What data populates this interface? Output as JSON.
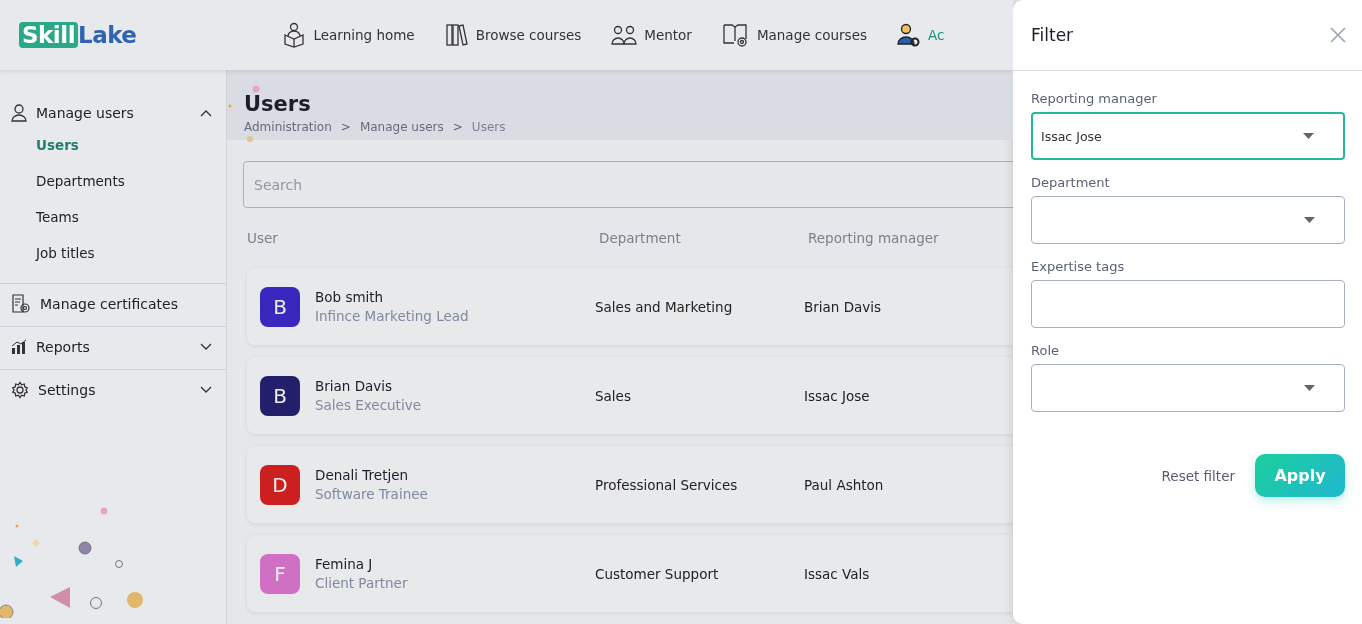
{
  "logo": {
    "part_1": "Skill",
    "part_2": "Lake"
  },
  "nav": [
    {
      "label": "Learning home",
      "selected": false
    },
    {
      "label": "Browse courses",
      "selected": false
    },
    {
      "label": "Mentor",
      "selected": false
    },
    {
      "label": "Manage courses",
      "selected": false
    },
    {
      "label": "Ac",
      "selected": true
    }
  ],
  "sidebar": [
    {
      "label": "Manage users",
      "expanded": true,
      "children": [
        {
          "label": "Users",
          "selected": true
        },
        {
          "label": "Departments",
          "selected": false
        },
        {
          "label": "Teams",
          "selected": false
        },
        {
          "label": "Job titles",
          "selected": false
        }
      ]
    },
    {
      "label": "Manage certificates"
    },
    {
      "label": "Reports",
      "expanded": false
    },
    {
      "label": "Settings",
      "expanded": false
    }
  ],
  "page": {
    "title": "Users",
    "breadcrumb": [
      "Administration",
      "Manage users",
      "Users"
    ],
    "breadcrumb_separator": ">"
  },
  "search": {
    "placeholder": "Search"
  },
  "table": {
    "columns": [
      "User",
      "Department",
      "Reporting manager"
    ],
    "rows": [
      {
        "initial": "B",
        "color": "#3a28be",
        "name": "Bob smith",
        "job_title": "Infince Marketing Lead",
        "department": "Sales and Marketing",
        "manager": "Brian Davis"
      },
      {
        "initial": "B",
        "color": "#241f6b",
        "name": "Brian Davis",
        "job_title": "Sales Executive",
        "department": "Sales",
        "manager": "Issac Jose"
      },
      {
        "initial": "D",
        "color": "#cc1f1f",
        "name": "Denali Tretjen",
        "job_title": "Software Trainee",
        "department": "Professional Services",
        "manager": "Paul Ashton"
      },
      {
        "initial": "F",
        "color": "#d070c4",
        "name": "Femina J",
        "job_title": "Client Partner",
        "department": "Customer Support",
        "manager": "Issac Vals"
      }
    ]
  },
  "filter": {
    "title": "Filter",
    "fields": [
      {
        "label": "Reporting manager",
        "kind": "select",
        "value": "Issac Jose",
        "focused": true
      },
      {
        "label": "Department",
        "kind": "select",
        "focused": false
      },
      {
        "label": "Expertise tags",
        "kind": "text",
        "focused": false
      },
      {
        "label": "Role",
        "kind": "select",
        "focused": false
      }
    ],
    "reset": "Reset filter",
    "apply": "Apply"
  }
}
